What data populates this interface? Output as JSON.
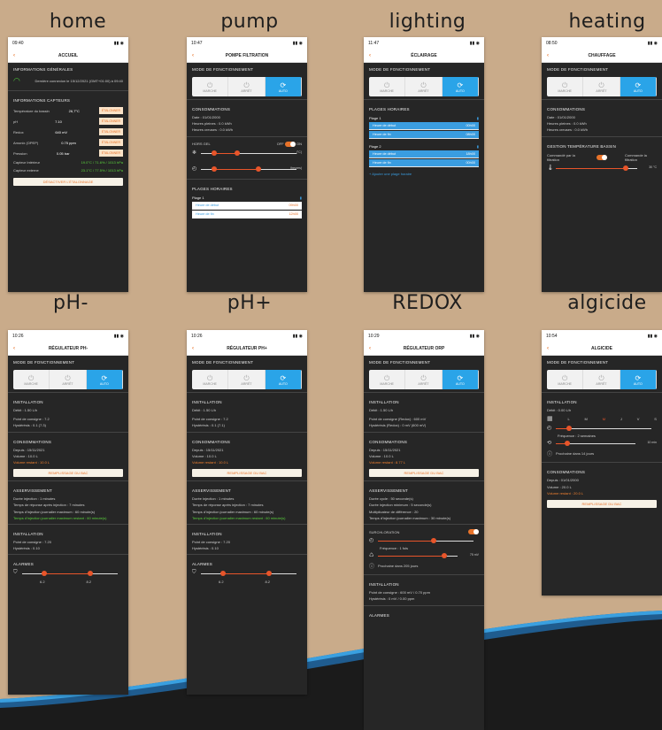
{
  "captions": [
    "home",
    "pump",
    "lighting",
    "heating",
    "pH-",
    "pH+",
    "REDOX",
    "algicide"
  ],
  "colors": {
    "background": "#c9ab8a",
    "accent": "#e8732a",
    "active_mode": "#2aa4e8",
    "panel": "#262626",
    "ok": "#5bd23d"
  },
  "modes": {
    "manual": "MARCHE",
    "off": "ARRÊT",
    "auto": "AUTO",
    "section": "MODE DE FONCTIONNEMENT"
  },
  "home": {
    "time": "09:40",
    "title": "ACCUEIL",
    "general_section": "INFORMATIONS GÉNÉRALES",
    "connection": "Dernière connexion le 15/12/2021 (GMT+01:00) à 09:40",
    "sensors_section": "INFORMATIONS CAPTEURS",
    "sensors": [
      {
        "label": "Température du bassin",
        "value": "26,7°C",
        "action": "ÉTALONNER"
      },
      {
        "label": "pH",
        "value": "7.10",
        "action": "ÉTALONNER"
      },
      {
        "label": "Redox",
        "value": "640 mV",
        "action": "ÉTALONNER"
      },
      {
        "label": "Amonix (OPEP)",
        "value": "0.75 ppm",
        "action": "ÉTALONNER"
      },
      {
        "label": "Pression",
        "value": "0.05 bar",
        "action": "ÉTALONNER"
      }
    ],
    "indoor": {
      "label": "Capteur Intérieur",
      "value": "19.0°C / 71.6% / 1013 hPa"
    },
    "outdoor": {
      "label": "Capteur externe",
      "value": "23.1°C / 77.5% / 1013 hPa"
    },
    "button": "DÉSACTIVER L'ÉTALONNAGE"
  },
  "pump": {
    "time": "10:47",
    "title": "POMPE FILTRATION",
    "cons_section": "CONSOMMATIONS",
    "cons": [
      "Date : 01/01/2000",
      "Heures pleines : 0.0 kWh",
      "Heures creuses : 0.0 kWh"
    ],
    "frost": "HORS GEL",
    "off": "OFF",
    "on": "ON",
    "unit_c": "(°C)",
    "unit_h": "(heures)",
    "slots_section": "PLAGES HORAIRES",
    "slot_label": "Plage 1",
    "start": "Heure de début",
    "start_val": "09h00",
    "end": "Heure de fin",
    "end_val": "12h00"
  },
  "lighting": {
    "time": "11:47",
    "title": "ÉCLAIRAGE",
    "slots_section": "PLAGES HORAIRES",
    "slots": [
      {
        "label": "Plage 1",
        "start": "Heure de début",
        "start_val": "00h00",
        "end": "Heure de fin",
        "end_val": "08h00"
      },
      {
        "label": "Plage 2",
        "start": "Heure de début",
        "start_val": "18h00",
        "end": "Heure de fin",
        "end_val": "00h00"
      }
    ],
    "add": "+ Ajouter une plage horaire"
  },
  "heating": {
    "time": "08:50",
    "title": "CHAUFFAGE",
    "cons_section": "CONSOMMATIONS",
    "cons": [
      "Date : 01/01/2000",
      "Heures pleines : 0.0 kWh",
      "Heures creuses : 0.0 kWh"
    ],
    "gestion": "GESTION TEMPÉRATURE BASSIN",
    "left": "Commandé par la filtration",
    "right": "Commande la filtration",
    "temp": "30 °C"
  },
  "phminus": {
    "time": "10:26",
    "title": "RÉGULATEUR PH-",
    "install_section": "INSTALLATION",
    "debit": "Débit : 1.50 L/h",
    "setpoint": "Point de consigne : 7.2",
    "hyst": "Hystérésis : 0.1 (7.3)",
    "cons_section": "CONSOMMATIONS",
    "cons": [
      "Depuis : 15/11/2021",
      "Volume : 10.0 L"
    ],
    "remaining": "Volume restant : 10.0 L",
    "refill": "REMPLISSAGE DU BAC",
    "asserv_section": "ASSERVISSEMENT",
    "asserv": [
      "Durée injection : 1 minutes",
      "Temps de réponse après injection : 7 minutes",
      "Temps d'injection journalier maximum : 60 minute(s)"
    ],
    "asserv_green": "Temps d'injection journalier maximum restant : 60 minute(s)",
    "install2": "INSTALLATION",
    "point": "Point de consigne : 7.20",
    "hyst2": "Hystérésis : 0.10",
    "alarms": "ALARMES",
    "a1": "6.2",
    "a2": "8.2"
  },
  "phplus": {
    "time": "10:26",
    "title": "RÉGULATEUR PH+",
    "install_section": "INSTALLATION",
    "debit": "Débit : 1.50 L/h",
    "setpoint": "Point de consigne : 7.2",
    "hyst": "Hystérésis : 0.1 (7.1)",
    "cons_section": "CONSOMMATIONS",
    "cons": [
      "Depuis : 15/11/2021",
      "Volume : 10.0 L"
    ],
    "remaining": "Volume restant : 10.0 L",
    "refill": "REMPLISSAGE DU BAC",
    "asserv_section": "ASSERVISSEMENT",
    "asserv": [
      "Durée injection : 1 minutes",
      "Temps de réponse après injection : 7 minutes",
      "Temps d'injection journalier maximum : 60 minute(s)"
    ],
    "asserv_green": "Temps d'injection journalier maximum restant : 60 minute(s)",
    "install2": "INSTALLATION",
    "point": "Point de consigne : 7.20",
    "hyst2": "Hystérésis : 0.10",
    "alarms": "ALARMES",
    "a1": "6.2",
    "a2": "8.2"
  },
  "redox": {
    "time": "10:29",
    "title": "RÉGULATEUR ORP",
    "install_section": "INSTALLATION",
    "debit": "Débit : 1.50 L/h",
    "setpoint": "Point de consigne (Redox) : 600 mV",
    "hyst": "Hystérésis (Redox) : 0 mV (600 mV)",
    "cons_section": "CONSOMMATIONS",
    "cons": [
      "Depuis : 15/11/2021",
      "Volume : 10.0 L"
    ],
    "remaining": "Volume restant : 8.77 L",
    "refill": "REMPLISSAGE DU BAC",
    "asserv_section": "ASSERVISSEMENT",
    "asserv": [
      "Durée cycle : 50 seconde(s)",
      "Durée injection minimum : 5 seconde(s)",
      "Multiplicateur de différence : 20",
      "Temps d'injection journalier maximum : 30 minute(s)"
    ],
    "surchlor": "SURCHLORATION",
    "freq": "Fréquence : 1 fois",
    "mv": "75 mV",
    "next": "Prochaine dans 205 jours",
    "install2": "INSTALLATION",
    "point": "Point de consigne : 600 mV / 0.70 ppm",
    "hyst2": "Hystérésis : 0 mV / 0.00 ppm",
    "alarms": "ALARMES"
  },
  "algicide": {
    "time": "10:54",
    "title": "ALGICIDE",
    "install_section": "INSTALLATION",
    "debit": "Débit : 0.00 L/h",
    "days": [
      "L",
      "M",
      "M",
      "J",
      "V",
      "S"
    ],
    "freq": "Fréquence : 2 semaines",
    "dur": "10 min",
    "next": "Prochaine dans 14 jours",
    "cons_section": "CONSOMMATIONS",
    "cons": [
      "Depuis : 01/01/2000",
      "Volume : 20.0 L"
    ],
    "remaining": "Volume restant : 20.0 L",
    "refill": "REMPLISSAGE DU BAC"
  }
}
